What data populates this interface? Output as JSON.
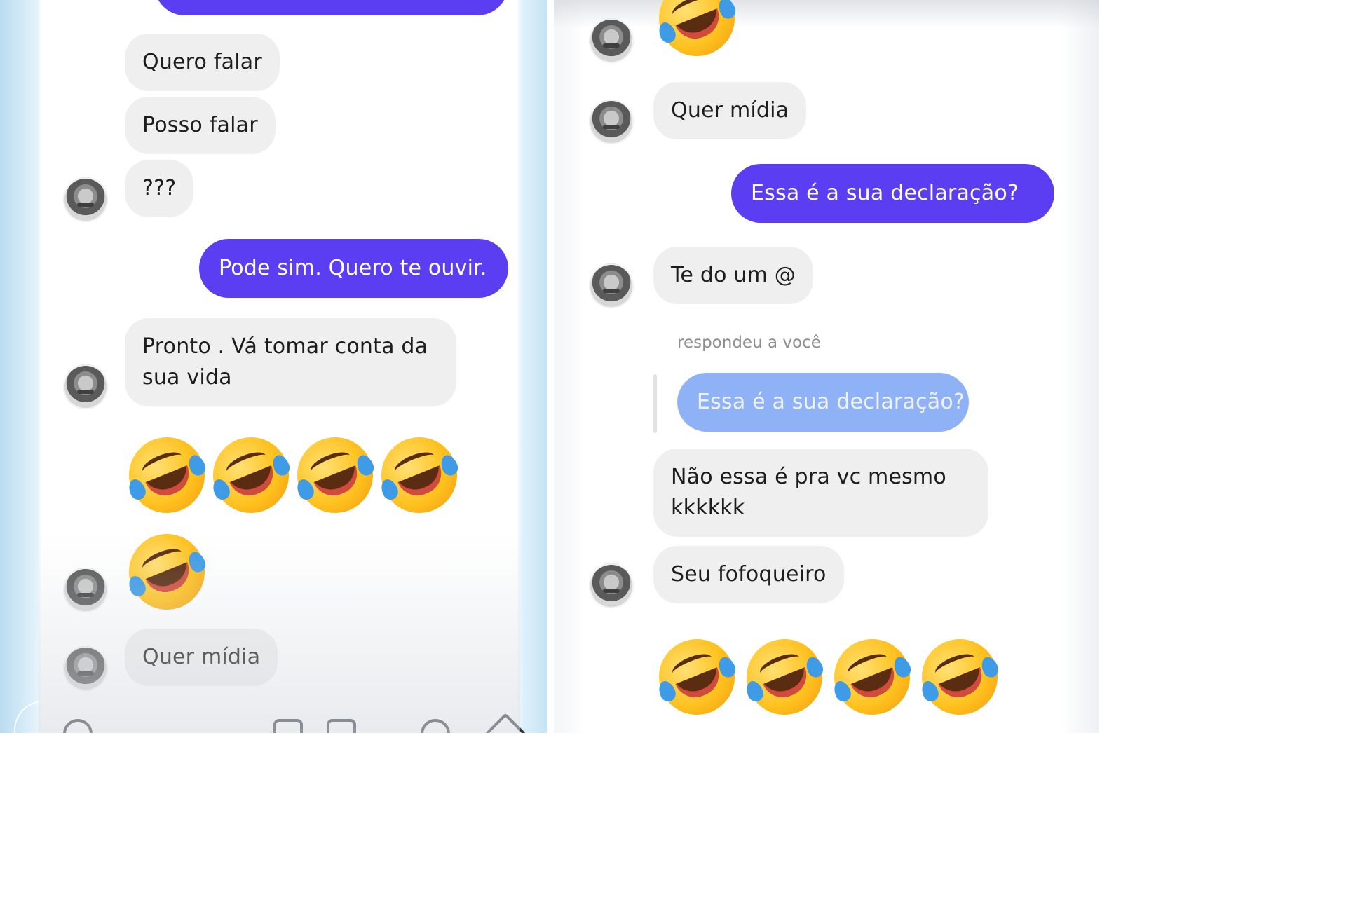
{
  "left": {
    "messages": {
      "quero_falar": "Quero falar",
      "posso_falar": "Posso falar",
      "question": "???",
      "pode_sim": "Pode sim. Quero te ouvir.",
      "pronto": "Pronto . Vá tomar conta da sua vida",
      "quer_midia": "Quer mídia"
    },
    "emoji": "rolling-on-the-floor-laughing"
  },
  "right": {
    "messages": {
      "quer_midia": "Quer mídia",
      "essa_declaracao": "Essa é a sua declaração?",
      "te_do_um": "Te do um @",
      "reply_label": "respondeu a você",
      "quoted": "Essa é a sua declaração?",
      "nao_essa": "Não essa é pra vc mesmo kkkkkk",
      "seu_fofoqueiro": "Seu fofoqueiro"
    },
    "emoji": "rolling-on-the-floor-laughing"
  },
  "colors": {
    "outgoing_bubble": "#5b3ef1",
    "incoming_bubble": "#efefef",
    "quoted_bubble": "#8fb2f7"
  }
}
